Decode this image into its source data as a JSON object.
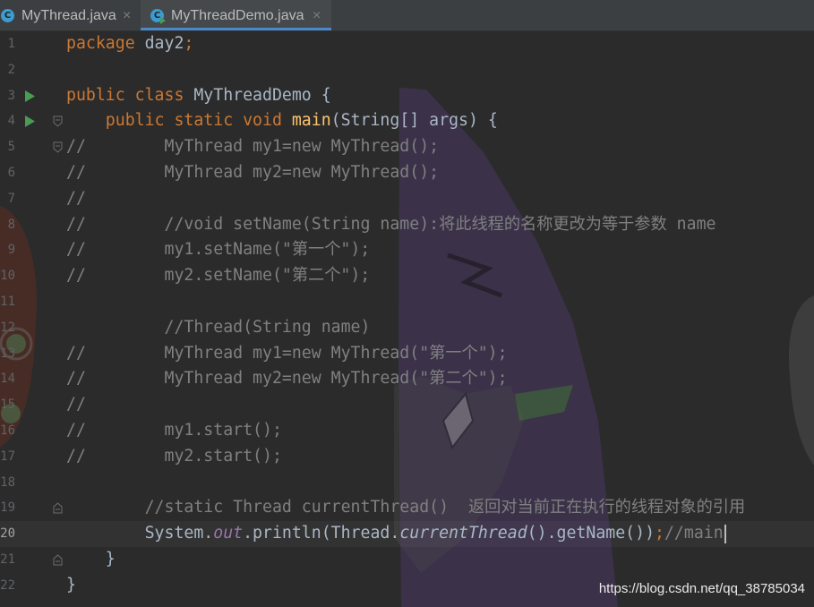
{
  "colors": {
    "tab_bar_bg": "#3c3f41",
    "active_tab_bg": "#45494b",
    "active_tab_underline": "#4a88c7",
    "editor_bg": "#2b2b2b",
    "keyword": "#cc7832",
    "plain": "#a9b7c6",
    "method_declaration": "#ffc66d",
    "comment": "#808080",
    "static_field": "#9876aa",
    "line_number": "#606366",
    "run_icon": "#499c54",
    "class_icon": "#3d9ccf"
  },
  "tabs": [
    {
      "icon": "java-class-icon",
      "icon_letter": "C",
      "label": "MyThread.java",
      "close": "×",
      "active": false
    },
    {
      "icon": "java-class-runnable-icon",
      "icon_letter": "C",
      "label": "MyThreadDemo.java",
      "close": "×",
      "active": true
    }
  ],
  "editor": {
    "current_line": 20,
    "lines": [
      {
        "number": 1,
        "segments": [
          {
            "text": "package",
            "color": "#cc7832"
          },
          {
            "text": " day2",
            "color": "#a9b7c6"
          },
          {
            "text": ";",
            "color": "#cc7832"
          }
        ]
      },
      {
        "number": 2,
        "segments": []
      },
      {
        "number": 3,
        "gutter_icon": "run-icon",
        "segments": [
          {
            "text": "public class",
            "color": "#cc7832"
          },
          {
            "text": " MyThreadDemo {",
            "color": "#a9b7c6"
          }
        ]
      },
      {
        "number": 4,
        "gutter_icon": "run-icon",
        "fold_icon": "fold-start-icon",
        "segments": [
          {
            "text": "    public static void ",
            "color": "#cc7832"
          },
          {
            "text": "main",
            "color": "#ffc66d"
          },
          {
            "text": "(String[] args) {",
            "color": "#a9b7c6"
          }
        ]
      },
      {
        "number": 5,
        "fold_icon": "fold-start-icon",
        "segments": [
          {
            "text": "//        MyThread my1=new MyThread();",
            "color": "#808080"
          }
        ]
      },
      {
        "number": 6,
        "segments": [
          {
            "text": "//        MyThread my2=new MyThread();",
            "color": "#808080"
          }
        ]
      },
      {
        "number": 7,
        "segments": [
          {
            "text": "//",
            "color": "#808080"
          }
        ]
      },
      {
        "number": 8,
        "segments": [
          {
            "text": "//        //void setName(String name):将此线程的名称更改为等于参数 name",
            "color": "#808080"
          }
        ]
      },
      {
        "number": 9,
        "segments": [
          {
            "text": "//        my1.setName(\"第一个\");",
            "color": "#808080"
          }
        ]
      },
      {
        "number": 10,
        "segments": [
          {
            "text": "//        my2.setName(\"第二个\");",
            "color": "#808080"
          }
        ]
      },
      {
        "number": 11,
        "segments": []
      },
      {
        "number": 12,
        "segments": [
          {
            "text": "          //Thread(String name)",
            "color": "#808080"
          }
        ]
      },
      {
        "number": 13,
        "segments": [
          {
            "text": "//        MyThread my1=new MyThread(\"第一个\");",
            "color": "#808080"
          }
        ]
      },
      {
        "number": 14,
        "segments": [
          {
            "text": "//        MyThread my2=new MyThread(\"第二个\");",
            "color": "#808080"
          }
        ]
      },
      {
        "number": 15,
        "segments": [
          {
            "text": "//",
            "color": "#808080"
          }
        ]
      },
      {
        "number": 16,
        "segments": [
          {
            "text": "//        my1.start();",
            "color": "#808080"
          }
        ]
      },
      {
        "number": 17,
        "segments": [
          {
            "text": "//        my2.start();",
            "color": "#808080"
          }
        ]
      },
      {
        "number": 18,
        "segments": []
      },
      {
        "number": 19,
        "fold_icon": "fold-end-icon",
        "segments": [
          {
            "text": "        //static Thread currentThread()  返回对当前正在执行的线程对象的引用",
            "color": "#808080"
          }
        ]
      },
      {
        "number": 20,
        "segments": [
          {
            "text": "        System.",
            "color": "#a9b7c6"
          },
          {
            "text": "out",
            "color": "#9876aa",
            "italic": true
          },
          {
            "text": ".println(Thread.",
            "color": "#a9b7c6"
          },
          {
            "text": "currentThread",
            "color": "#a9b7c6",
            "italic": true
          },
          {
            "text": "().getName())",
            "color": "#a9b7c6"
          },
          {
            "text": ";",
            "color": "#cc7832"
          },
          {
            "text": "//main",
            "color": "#808080"
          }
        ]
      },
      {
        "number": 21,
        "fold_icon": "fold-end-icon",
        "segments": [
          {
            "text": "    }",
            "color": "#a9b7c6"
          }
        ]
      },
      {
        "number": 22,
        "segments": [
          {
            "text": "}",
            "color": "#a9b7c6"
          }
        ]
      }
    ]
  },
  "watermark": "https://blog.csdn.net/qq_38785034"
}
